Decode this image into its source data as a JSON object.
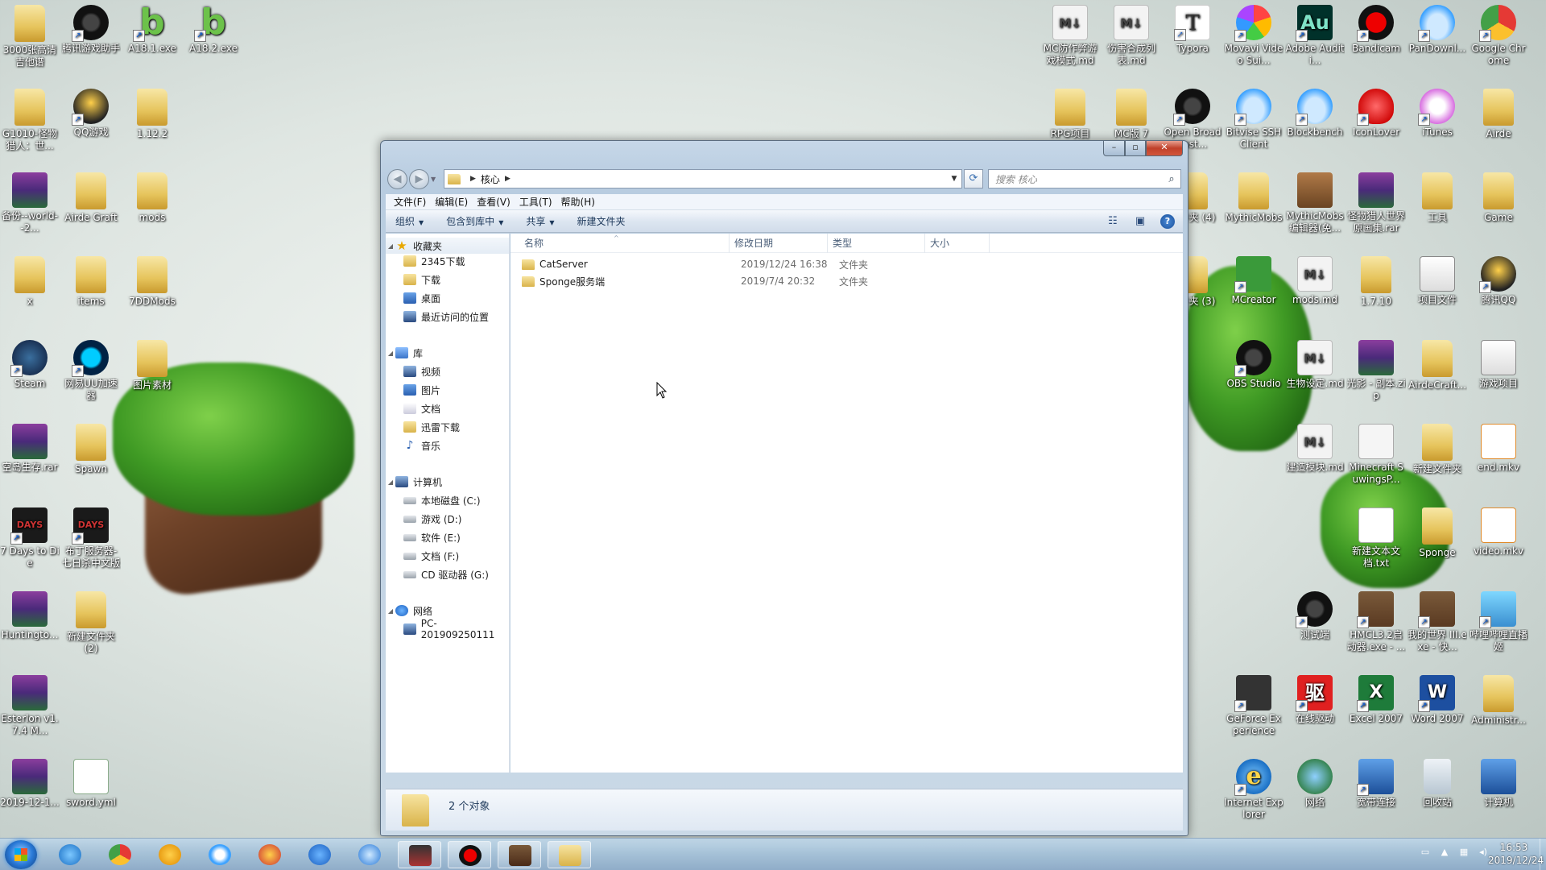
{
  "desktop": {
    "icons_left": [
      {
        "label": "3000张高清吉他谱",
        "icon": "folder-icon"
      },
      {
        "label": "腾讯游戏助手",
        "icon": "app-icon"
      },
      {
        "label": "A18.1.exe",
        "icon": "exe-b-icon"
      },
      {
        "label": "A18.2.exe",
        "icon": "exe-b-icon"
      },
      {
        "label": "G1010-怪物猎人：世...",
        "icon": "folder-icon"
      },
      {
        "label": "QQ游戏",
        "icon": "qq-game-icon"
      },
      {
        "label": "1.12.2",
        "icon": "folder-icon"
      },
      {
        "label": "备份--world--2...",
        "icon": "rar-icon"
      },
      {
        "label": "Airde Graft",
        "icon": "folder-icon"
      },
      {
        "label": "mods",
        "icon": "folder-icon"
      },
      {
        "label": "x",
        "icon": "folder-icon"
      },
      {
        "label": "items",
        "icon": "folder-icon"
      },
      {
        "label": "7DDMods",
        "icon": "folder-icon"
      },
      {
        "label": "Steam",
        "icon": "steam-icon"
      },
      {
        "label": "网易UU加速器",
        "icon": "uu-icon"
      },
      {
        "label": "图片素材",
        "icon": "folder-icon"
      },
      {
        "label": "空岛生存.rar",
        "icon": "rar-icon"
      },
      {
        "label": "Spawn",
        "icon": "folder-icon"
      },
      {
        "label": "7 Days to Die",
        "icon": "days-icon"
      },
      {
        "label": "布丁服务器-七日杀中文版",
        "icon": "days-icon"
      },
      {
        "label": "Huntingto...",
        "icon": "rar-icon"
      },
      {
        "label": "新建文件夹 (2)",
        "icon": "folder-icon"
      },
      {
        "label": "Esterlon v1.7.4 M...",
        "icon": "rar-icon"
      },
      {
        "label": "2019-12-1...",
        "icon": "rar-icon"
      },
      {
        "label": "sword.yml",
        "icon": "yml-icon"
      }
    ],
    "icons_right": [
      {
        "label": "MC防作弊游戏模式.md",
        "icon": "md-icon"
      },
      {
        "label": "伤害合成列表.md",
        "icon": "md-icon"
      },
      {
        "label": "Typora",
        "icon": "typora-icon"
      },
      {
        "label": "Movavi Video Sui...",
        "icon": "movavi-icon"
      },
      {
        "label": "Adobe Auditi...",
        "icon": "audition-icon"
      },
      {
        "label": "Bandicam",
        "icon": "bandicam-icon"
      },
      {
        "label": "PanDownl...",
        "icon": "pandownload-icon"
      },
      {
        "label": "Google Chrome",
        "icon": "chrome-icon"
      },
      {
        "label": "RPG项目",
        "icon": "folder-icon"
      },
      {
        "label": "MC版 7",
        "icon": "folder-icon"
      },
      {
        "label": "Open Broadcast...",
        "icon": "obs-icon"
      },
      {
        "label": "Bitvise SSH Client",
        "icon": "bitvise-icon"
      },
      {
        "label": "Blockbench",
        "icon": "blockbench-icon"
      },
      {
        "label": "IconLover",
        "icon": "iconlover-icon"
      },
      {
        "label": "iTunes",
        "icon": "itunes-icon"
      },
      {
        "label": "Airde",
        "icon": "folder-icon"
      },
      {
        "label": "文件夹 (4)",
        "icon": "folder-icon"
      },
      {
        "label": "MythicMobs",
        "icon": "folder-icon"
      },
      {
        "label": "MythicMobs编辑器(免...",
        "icon": "book-icon"
      },
      {
        "label": "怪物猎人世界原画集.rar",
        "icon": "rar-icon"
      },
      {
        "label": "工具",
        "icon": "folder-icon"
      },
      {
        "label": "Game",
        "icon": "folder-icon"
      },
      {
        "label": "文件夹 (3)",
        "icon": "folder-icon"
      },
      {
        "label": "MCreator",
        "icon": "mcreator-icon"
      },
      {
        "label": "mods.md",
        "icon": "md-icon"
      },
      {
        "label": "1.7.10",
        "icon": "folder-icon"
      },
      {
        "label": "项目文件",
        "icon": "drive-icon"
      },
      {
        "label": "腾讯QQ",
        "icon": "qq-icon"
      },
      {
        "label": "OBS Studio",
        "icon": "obs-icon"
      },
      {
        "label": "生物设定.md",
        "icon": "md-icon"
      },
      {
        "label": "光影 - 副本.zip",
        "icon": "rar-icon"
      },
      {
        "label": "AirdeCraft...",
        "icon": "folder-icon"
      },
      {
        "label": "游戏项目",
        "icon": "drive-icon"
      },
      {
        "label": "建造模块.md",
        "icon": "md-icon"
      },
      {
        "label": "Minecraft SuwingsP...",
        "icon": "doc-icon"
      },
      {
        "label": "新建文件夹",
        "icon": "folder-icon"
      },
      {
        "label": "end.mkv",
        "icon": "video-icon"
      },
      {
        "label": "新建文本文档.txt",
        "icon": "txt-icon"
      },
      {
        "label": "Sponge",
        "icon": "folder-icon"
      },
      {
        "label": "video.mkv",
        "icon": "video-icon"
      },
      {
        "label": "测试端",
        "icon": "app-icon"
      },
      {
        "label": "HMCL3.2启动器.exe - ...",
        "icon": "minecraft-icon"
      },
      {
        "label": "我的世界 III.exe - 快...",
        "icon": "minecraft-icon"
      },
      {
        "label": "哔哩哔哩直播姬",
        "icon": "live-icon"
      },
      {
        "label": "GeForce Experience",
        "icon": "nvidia-icon"
      },
      {
        "label": "在线驱动",
        "icon": "driver-icon"
      },
      {
        "label": "Excel 2007",
        "icon": "excel-icon"
      },
      {
        "label": "Word 2007",
        "icon": "word-icon"
      },
      {
        "label": "Administr...",
        "icon": "user-folder-icon"
      },
      {
        "label": "Internet Explorer",
        "icon": "ie-icon"
      },
      {
        "label": "网络",
        "icon": "network-icon"
      },
      {
        "label": "宽带连接",
        "icon": "broadband-icon"
      },
      {
        "label": "回收站",
        "icon": "recycle-bin-icon"
      },
      {
        "label": "计算机",
        "icon": "computer-icon"
      }
    ]
  },
  "explorer": {
    "address": {
      "path": [
        "核心"
      ],
      "search_placeholder": "搜索 核心"
    },
    "menu": [
      "文件(F)",
      "编辑(E)",
      "查看(V)",
      "工具(T)",
      "帮助(H)"
    ],
    "toolbar": {
      "organize": "组织",
      "include_in_library": "包含到库中",
      "share": "共享",
      "new_folder": "新建文件夹"
    },
    "nav": {
      "favorites": {
        "label": "收藏夹",
        "items": [
          "2345下载",
          "下载",
          "桌面",
          "最近访问的位置"
        ]
      },
      "libraries": {
        "label": "库",
        "items": [
          "视频",
          "图片",
          "文档",
          "迅雷下载",
          "音乐"
        ]
      },
      "computer": {
        "label": "计算机",
        "items": [
          "本地磁盘 (C:)",
          "游戏 (D:)",
          "软件 (E:)",
          "文档 (F:)",
          "CD 驱动器 (G:)"
        ]
      },
      "network": {
        "label": "网络",
        "items": [
          "PC-201909250111"
        ]
      }
    },
    "columns": {
      "name": "名称",
      "date": "修改日期",
      "type": "类型",
      "size": "大小"
    },
    "files": [
      {
        "name": "CatServer",
        "date": "2019/12/24 16:38",
        "type": "文件夹"
      },
      {
        "name": "Sponge服务端",
        "date": "2019/7/4 20:32",
        "type": "文件夹"
      }
    ],
    "status": "2 个对象"
  },
  "taskbar": {
    "clock_time": "16:53",
    "clock_date": "2019/12/24"
  }
}
